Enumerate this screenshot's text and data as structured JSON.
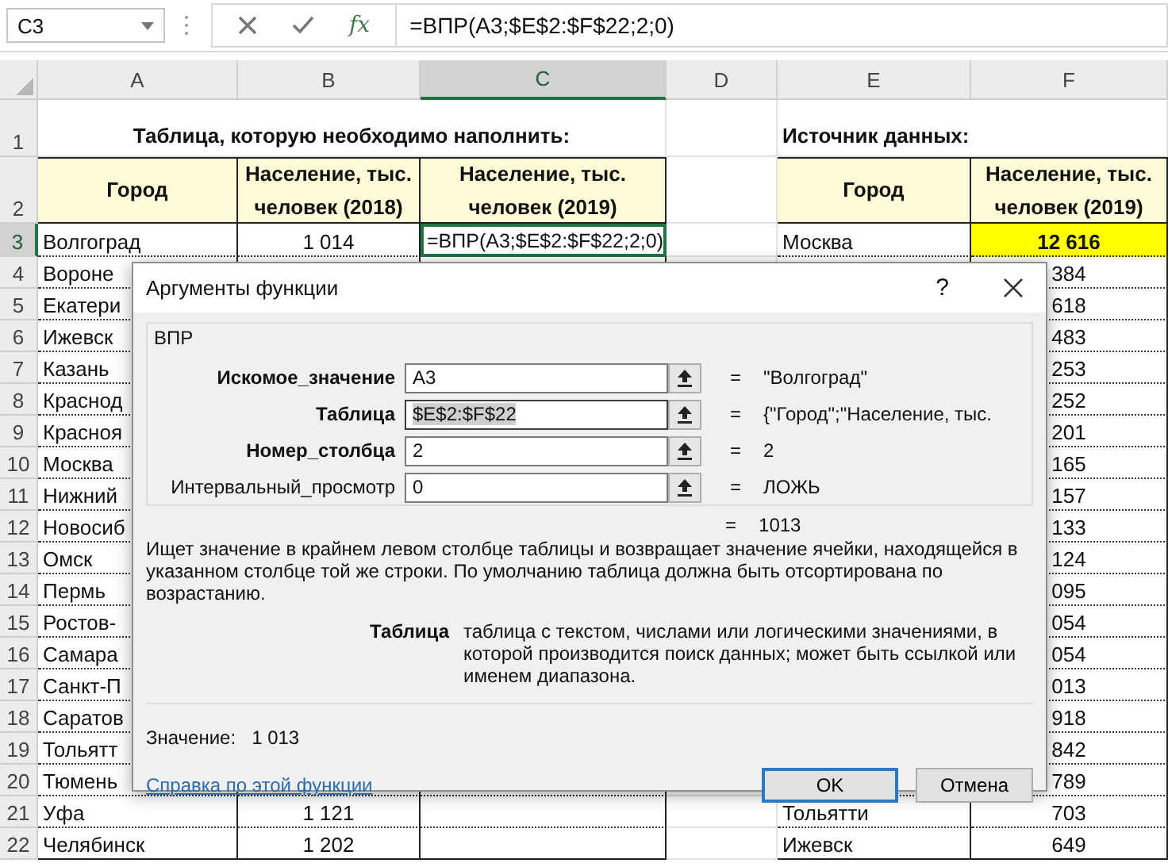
{
  "name_box": "C3",
  "fx": "fx",
  "formula": "=ВПР(A3;$E$2:$F$22;2;0)",
  "sheet": {
    "columns": [
      {
        "label": "A",
        "selected": false
      },
      {
        "label": "B",
        "selected": false
      },
      {
        "label": "C",
        "selected": true
      },
      {
        "label": "D",
        "selected": false
      },
      {
        "label": "E",
        "selected": false
      },
      {
        "label": "F",
        "selected": false
      }
    ],
    "rows": [
      {
        "number": "1",
        "selected": false,
        "cells": [
          {
            "kind": "title",
            "text": "Таблица, которую необходимо наполнить:"
          },
          {
            "kind": "merged"
          },
          {
            "kind": "merged"
          },
          {
            "kind": "blank"
          },
          {
            "kind": "title",
            "text": "Источник данных:"
          },
          {
            "kind": "merged"
          }
        ]
      },
      {
        "number": "2",
        "selected": false,
        "cells": [
          {
            "kind": "header",
            "text": "Город"
          },
          {
            "kind": "header",
            "text": "Население, тыс. человек (2018)"
          },
          {
            "kind": "header",
            "text": "Население, тыс. человек (2019)"
          },
          {
            "kind": "blank"
          },
          {
            "kind": "header",
            "text": "Город"
          },
          {
            "kind": "header",
            "text": "Население, тыс. человек (2019)"
          }
        ]
      },
      {
        "number": "3",
        "selected": true,
        "cells": [
          {
            "kind": "text",
            "text": "Волгоград"
          },
          {
            "kind": "number",
            "text": "1 014"
          },
          {
            "kind": "formula",
            "text": "=ВПР(A3;$E$2:$F$22;2;0)"
          },
          {
            "kind": "blank"
          },
          {
            "kind": "text",
            "text": "Москва"
          },
          {
            "kind": "highlight",
            "text": "12 616"
          }
        ]
      },
      {
        "number": "4",
        "selected": false,
        "cells": [
          {
            "kind": "text",
            "text": "Вороне"
          },
          {
            "kind": "covered"
          },
          {
            "kind": "covered"
          },
          {
            "kind": "covered"
          },
          {
            "kind": "covered"
          },
          {
            "kind": "number",
            "text": "384"
          }
        ]
      },
      {
        "number": "5",
        "selected": false,
        "cells": [
          {
            "kind": "text",
            "text": "Екатери"
          },
          {
            "kind": "covered"
          },
          {
            "kind": "covered"
          },
          {
            "kind": "covered"
          },
          {
            "kind": "covered"
          },
          {
            "kind": "number",
            "text": "618"
          }
        ]
      },
      {
        "number": "6",
        "selected": false,
        "cells": [
          {
            "kind": "text",
            "text": "Ижевск"
          },
          {
            "kind": "covered"
          },
          {
            "kind": "covered"
          },
          {
            "kind": "covered"
          },
          {
            "kind": "covered"
          },
          {
            "kind": "number",
            "text": "483"
          }
        ]
      },
      {
        "number": "7",
        "selected": false,
        "cells": [
          {
            "kind": "text",
            "text": "Казань"
          },
          {
            "kind": "covered"
          },
          {
            "kind": "covered"
          },
          {
            "kind": "covered"
          },
          {
            "kind": "covered"
          },
          {
            "kind": "number",
            "text": "253"
          }
        ]
      },
      {
        "number": "8",
        "selected": false,
        "cells": [
          {
            "kind": "text",
            "text": "Краснод"
          },
          {
            "kind": "covered"
          },
          {
            "kind": "covered"
          },
          {
            "kind": "covered"
          },
          {
            "kind": "covered"
          },
          {
            "kind": "number",
            "text": "252"
          }
        ]
      },
      {
        "number": "9",
        "selected": false,
        "cells": [
          {
            "kind": "text",
            "text": "Красноя"
          },
          {
            "kind": "covered"
          },
          {
            "kind": "covered"
          },
          {
            "kind": "covered"
          },
          {
            "kind": "covered"
          },
          {
            "kind": "number",
            "text": "201"
          }
        ]
      },
      {
        "number": "10",
        "selected": false,
        "cells": [
          {
            "kind": "text",
            "text": "Москва"
          },
          {
            "kind": "covered"
          },
          {
            "kind": "covered"
          },
          {
            "kind": "covered"
          },
          {
            "kind": "covered"
          },
          {
            "kind": "number",
            "text": "165"
          }
        ]
      },
      {
        "number": "11",
        "selected": false,
        "cells": [
          {
            "kind": "text",
            "text": "Нижний"
          },
          {
            "kind": "covered"
          },
          {
            "kind": "covered"
          },
          {
            "kind": "covered"
          },
          {
            "kind": "covered"
          },
          {
            "kind": "number",
            "text": "157"
          }
        ]
      },
      {
        "number": "12",
        "selected": false,
        "cells": [
          {
            "kind": "text",
            "text": "Новосиб"
          },
          {
            "kind": "covered"
          },
          {
            "kind": "covered"
          },
          {
            "kind": "covered"
          },
          {
            "kind": "covered"
          },
          {
            "kind": "number",
            "text": "133"
          }
        ]
      },
      {
        "number": "13",
        "selected": false,
        "cells": [
          {
            "kind": "text",
            "text": "Омск"
          },
          {
            "kind": "covered"
          },
          {
            "kind": "covered"
          },
          {
            "kind": "covered"
          },
          {
            "kind": "covered"
          },
          {
            "kind": "number",
            "text": "124"
          }
        ]
      },
      {
        "number": "14",
        "selected": false,
        "cells": [
          {
            "kind": "text",
            "text": "Пермь"
          },
          {
            "kind": "covered"
          },
          {
            "kind": "covered"
          },
          {
            "kind": "covered"
          },
          {
            "kind": "covered"
          },
          {
            "kind": "number",
            "text": "095"
          }
        ]
      },
      {
        "number": "15",
        "selected": false,
        "cells": [
          {
            "kind": "text",
            "text": "Ростов-"
          },
          {
            "kind": "covered"
          },
          {
            "kind": "covered"
          },
          {
            "kind": "covered"
          },
          {
            "kind": "covered"
          },
          {
            "kind": "number",
            "text": "054"
          }
        ]
      },
      {
        "number": "16",
        "selected": false,
        "cells": [
          {
            "kind": "text",
            "text": "Самара"
          },
          {
            "kind": "covered"
          },
          {
            "kind": "covered"
          },
          {
            "kind": "covered"
          },
          {
            "kind": "covered"
          },
          {
            "kind": "number",
            "text": "054"
          }
        ]
      },
      {
        "number": "17",
        "selected": false,
        "cells": [
          {
            "kind": "text",
            "text": "Санкт-П"
          },
          {
            "kind": "covered"
          },
          {
            "kind": "covered"
          },
          {
            "kind": "covered"
          },
          {
            "kind": "covered"
          },
          {
            "kind": "number",
            "text": "013"
          }
        ]
      },
      {
        "number": "18",
        "selected": false,
        "cells": [
          {
            "kind": "text",
            "text": "Саратов"
          },
          {
            "kind": "covered"
          },
          {
            "kind": "covered"
          },
          {
            "kind": "covered"
          },
          {
            "kind": "covered"
          },
          {
            "kind": "number",
            "text": "918"
          }
        ]
      },
      {
        "number": "19",
        "selected": false,
        "cells": [
          {
            "kind": "text",
            "text": "Тольятт"
          },
          {
            "kind": "covered"
          },
          {
            "kind": "covered"
          },
          {
            "kind": "covered"
          },
          {
            "kind": "covered"
          },
          {
            "kind": "number",
            "text": "842"
          }
        ]
      },
      {
        "number": "20",
        "selected": false,
        "cells": [
          {
            "kind": "text",
            "text": "Тюмень"
          },
          {
            "kind": "covered"
          },
          {
            "kind": "covered"
          },
          {
            "kind": "covered"
          },
          {
            "kind": "covered"
          },
          {
            "kind": "number",
            "text": "789"
          }
        ]
      },
      {
        "number": "21",
        "selected": false,
        "cells": [
          {
            "kind": "text",
            "text": "Уфа"
          },
          {
            "kind": "number",
            "text": "1 121"
          },
          {
            "kind": "blank"
          },
          {
            "kind": "blank"
          },
          {
            "kind": "text",
            "text": "Тольятти"
          },
          {
            "kind": "number",
            "text": "703"
          }
        ]
      },
      {
        "number": "22",
        "selected": false,
        "cells": [
          {
            "kind": "text",
            "text": "Челябинск"
          },
          {
            "kind": "number",
            "text": "1 202"
          },
          {
            "kind": "blank"
          },
          {
            "kind": "blank"
          },
          {
            "kind": "text",
            "text": "Ижевск"
          },
          {
            "kind": "number",
            "text": "649"
          }
        ]
      }
    ]
  },
  "dialog": {
    "title": "Аргументы функции",
    "help": "?",
    "function_name": "ВПР",
    "arguments": [
      {
        "label": "Искомое_значение",
        "required": true,
        "value": "A3",
        "value_selected": false,
        "sign": "=",
        "result": "\"Волгоград\""
      },
      {
        "label": "Таблица",
        "required": true,
        "value": "$E$2:$F$22",
        "value_selected": true,
        "sign": "=",
        "result": "{\"Город\";\"Население, тыс."
      },
      {
        "label": "Номер_столбца",
        "required": true,
        "value": "2",
        "value_selected": false,
        "sign": "=",
        "result": "2"
      },
      {
        "label": "Интервальный_просмотр",
        "required": false,
        "value": "0",
        "value_selected": false,
        "sign": "=",
        "result": "ЛОЖЬ"
      }
    ],
    "result_sign": "=",
    "result": "1013",
    "description": "Ищет значение в крайнем левом столбце таблицы и возвращает значение ячейки, находящейся в указанном столбце той же строки. По умолчанию таблица должна быть отсортирована по возрастанию.",
    "argument_name": "Таблица",
    "argument_help": "таблица с текстом, числами или логическими значениями, в которой производится поиск данных; может быть ссылкой или именем диапазона.",
    "value_label": "Значение:",
    "value": "1 013",
    "help_link": "Справка по этой функции",
    "buttons": [
      {
        "label": "OK",
        "default": true
      },
      {
        "label": "Отмена",
        "default": false
      }
    ]
  }
}
